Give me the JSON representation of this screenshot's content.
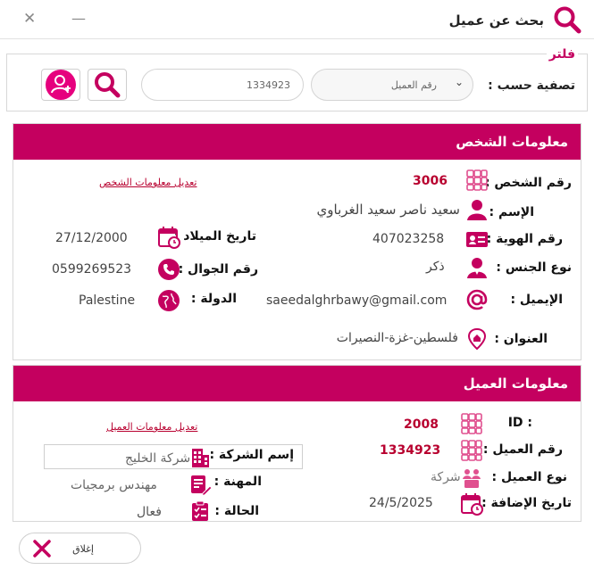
{
  "window": {
    "title": "بحث عن عميل",
    "minimize": "—",
    "close": "✕"
  },
  "filter": {
    "legend": "فلتر",
    "sort_label": "تصفية حسب :",
    "sort_value": "رقم العميل",
    "search_value": "1334923",
    "search_icon": "search-icon",
    "add_user_icon": "add-user-icon"
  },
  "person": {
    "header": "معلومات الشخص",
    "edit_link": "تعديل معلومات الشخص",
    "person_no_label": "رقم الشخص :",
    "person_no": "3006",
    "name_label": "الإسم :",
    "name": "سعيد ناصر سعيد الغرباوي",
    "birth_label": "تاريخ الميلاد :",
    "birth": "27/12/2000",
    "id_label": "رقم الهوية :",
    "id": "407023258",
    "mobile_label": "رقم الجوال :",
    "mobile": "0599269523",
    "gender_label": "نوع الجنس :",
    "gender": "ذكر",
    "country_label": "الدولة :",
    "country": "Palestine",
    "email_label": "الإيميل :",
    "email": "saeedalghrbawy@gmail.com",
    "address_label": "العنوان :",
    "address": "فلسطين-غزة-النصيرات"
  },
  "client": {
    "header": "معلومات العميل",
    "edit_link": "تعديل معلومات العميل",
    "id_label": "ID :",
    "id": "2008",
    "client_no_label": "رقم العميل :",
    "client_no": "1334923",
    "company_label": "إسم الشركة :",
    "company": "شركة الخليج",
    "type_label": "نوع العميل :",
    "type": "شركة",
    "job_label": "المهنة :",
    "job": "مهندس برمجيات",
    "added_label": "تاريخ الإضافة :",
    "added": "24/5/2025",
    "status_label": "الحالة :",
    "status": "فعال"
  },
  "footer": {
    "close_label": "إغلاق"
  },
  "colors": {
    "accent": "#c4005f",
    "value_red": "#b8002f"
  }
}
